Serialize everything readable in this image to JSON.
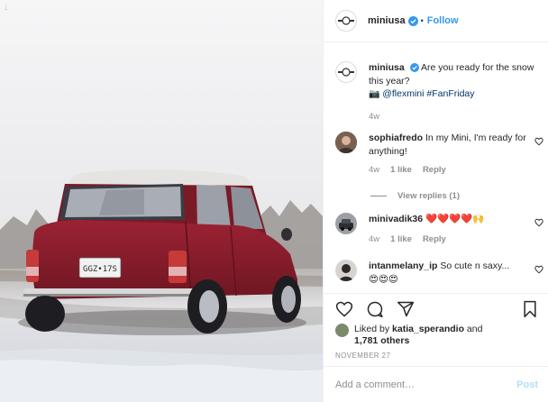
{
  "post": {
    "author": "miniusa",
    "follow_label": "Follow",
    "separator": "•",
    "plate_text": "GGZ•17S"
  },
  "caption": {
    "username": "miniusa",
    "text": "Are you ready for the snow this year?",
    "line2_prefix": "📷 ",
    "mention": "@flexmini",
    "hashtag": "#FanFriday",
    "age": "4w"
  },
  "comments": [
    {
      "username": "sophiafredo",
      "text": "In my Mini, I'm ready for anything!",
      "age": "4w",
      "likes": "1 like",
      "reply_label": "Reply"
    },
    {
      "username": "minivadik36",
      "text": "❤️❤️❤️❤️🙌",
      "age": "4w",
      "likes": "1 like",
      "reply_label": "Reply"
    },
    {
      "username": "intanmelany_ip",
      "text": "So cute n saxy...",
      "text_line2": "😍😍😍"
    }
  ],
  "view_replies_label": "View replies (1)",
  "likes": {
    "prefix": "Liked by ",
    "liker": "katia_sperandio",
    "middle": " and",
    "others": "1,781 others"
  },
  "date": "NOVEMBER 27",
  "add_comment": {
    "placeholder": "Add a comment…",
    "post_label": "Post"
  },
  "colors": {
    "link_blue": "#3897f0",
    "post_disabled": "#b2dffc",
    "car_red": "#8a1f2c"
  },
  "icons": [
    "mini-logo-icon",
    "verified-badge-icon",
    "heart-icon",
    "comment-icon",
    "share-icon",
    "bookmark-icon",
    "small-heart-icon"
  ]
}
